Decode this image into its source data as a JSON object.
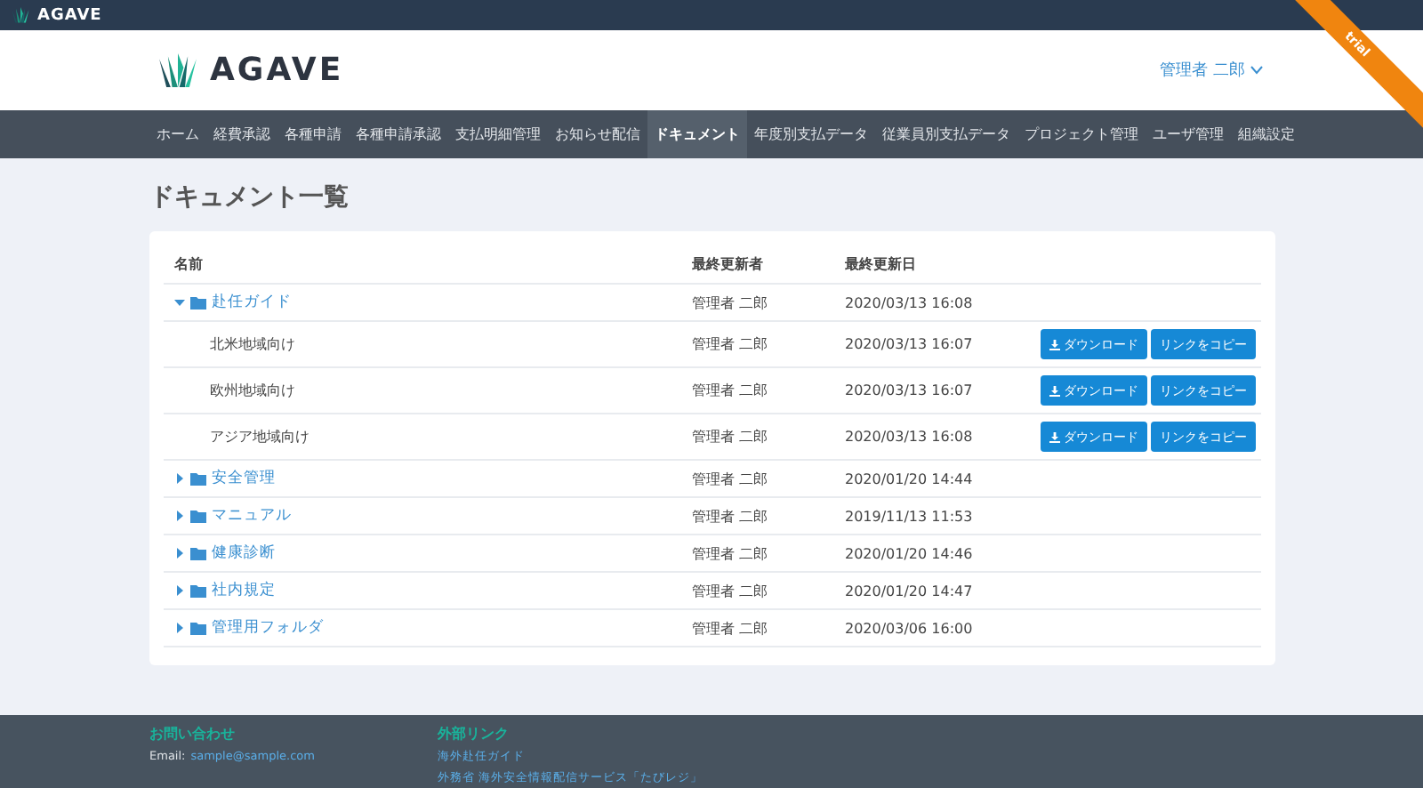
{
  "top_bar": {
    "brand": "AGAVE"
  },
  "ribbon": {
    "text": "trial"
  },
  "header": {
    "brand": "AGAVE",
    "user": "管理者 二郎"
  },
  "nav": [
    {
      "label": "ホーム",
      "selected": false
    },
    {
      "label": "経費承認",
      "selected": false
    },
    {
      "label": "各種申請",
      "selected": false
    },
    {
      "label": "各種申請承認",
      "selected": false
    },
    {
      "label": "支払明細管理",
      "selected": false
    },
    {
      "label": "お知らせ配信",
      "selected": false
    },
    {
      "label": "ドキュメント",
      "selected": true
    },
    {
      "label": "年度別支払データ",
      "selected": false
    },
    {
      "label": "従業員別支払データ",
      "selected": false
    },
    {
      "label": "プロジェクト管理",
      "selected": false
    },
    {
      "label": "ユーザ管理",
      "selected": false
    },
    {
      "label": "組織設定",
      "selected": false
    }
  ],
  "page_title": "ドキュメント一覧",
  "table": {
    "columns": [
      "名前",
      "最終更新者",
      "最終更新日"
    ],
    "rows": [
      {
        "kind": "folder",
        "name": "赴任ガイド",
        "updater": "管理者 二郎",
        "updated": "2020/03/13 16:08",
        "expanded": true,
        "children": [
          {
            "kind": "file",
            "name": "北米地域向け",
            "updater": "管理者 二郎",
            "updated": "2020/03/13 16:07",
            "buttons": [
              "ダウンロード",
              "リンクをコピー"
            ]
          },
          {
            "kind": "file",
            "name": "欧州地域向け",
            "updater": "管理者 二郎",
            "updated": "2020/03/13 16:07",
            "buttons": [
              "ダウンロード",
              "リンクをコピー"
            ]
          },
          {
            "kind": "file",
            "name": "アジア地域向け",
            "updater": "管理者 二郎",
            "updated": "2020/03/13 16:08",
            "buttons": [
              "ダウンロード",
              "リンクをコピー"
            ]
          }
        ]
      },
      {
        "kind": "folder",
        "name": "安全管理",
        "updater": "管理者 二郎",
        "updated": "2020/01/20 14:44",
        "expanded": false
      },
      {
        "kind": "folder",
        "name": "マニュアル",
        "updater": "管理者 二郎",
        "updated": "2019/11/13 11:53",
        "expanded": false
      },
      {
        "kind": "folder",
        "name": "健康診断",
        "updater": "管理者 二郎",
        "updated": "2020/01/20 14:46",
        "expanded": false
      },
      {
        "kind": "folder",
        "name": "社内規定",
        "updater": "管理者 二郎",
        "updated": "2020/01/20 14:47",
        "expanded": false
      },
      {
        "kind": "folder",
        "name": "管理用フォルダ",
        "updater": "管理者 二郎",
        "updated": "2020/03/06 16:00",
        "expanded": false
      }
    ]
  },
  "footer": {
    "contact": {
      "title": "お問い合わせ",
      "label": "Email:",
      "email": "sample@sample.com"
    },
    "links": {
      "title": "外部リンク",
      "items": [
        "海外赴任ガイド",
        "外務省 海外安全情報配信サービス「たびレジ」"
      ]
    }
  }
}
